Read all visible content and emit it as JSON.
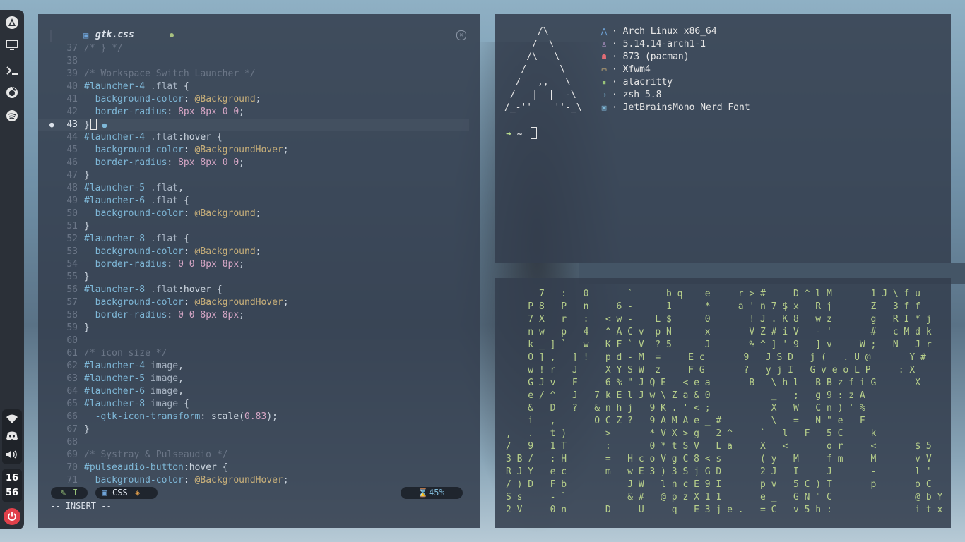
{
  "sidebar": {
    "top_icons": [
      "arch-logo-icon",
      "monitor-icon",
      "terminal-icon",
      "firefox-icon",
      "spotify-icon"
    ],
    "bottom_icons": [
      "wifi-icon",
      "discord-icon",
      "volume-icon"
    ],
    "clock": {
      "hour": "16",
      "minute": "56"
    },
    "power_icon": "power-icon"
  },
  "editor": {
    "tab": {
      "filename": "gtk.css",
      "modified": true
    },
    "lines": [
      {
        "n": "37",
        "t": "/* } */",
        "k": "com"
      },
      {
        "n": "38",
        "t": "",
        "k": "plain"
      },
      {
        "n": "39",
        "t": "/* Workspace Switch Launcher */",
        "k": "com"
      },
      {
        "n": "40",
        "t": "#launcher-4 .flat {",
        "k": "sel"
      },
      {
        "n": "41",
        "t": "  background-color: @Background;",
        "k": "decl"
      },
      {
        "n": "42",
        "t": "  border-radius: 8px 8px 0 0;",
        "k": "decl"
      },
      {
        "n": "43",
        "t": "}",
        "k": "cur"
      },
      {
        "n": "44",
        "t": "#launcher-4 .flat:hover {",
        "k": "sel"
      },
      {
        "n": "45",
        "t": "  background-color: @BackgroundHover;",
        "k": "decl"
      },
      {
        "n": "46",
        "t": "  border-radius: 8px 8px 0 0;",
        "k": "decl"
      },
      {
        "n": "47",
        "t": "}",
        "k": "plain"
      },
      {
        "n": "48",
        "t": "#launcher-5 .flat,",
        "k": "sel"
      },
      {
        "n": "49",
        "t": "#launcher-6 .flat {",
        "k": "sel"
      },
      {
        "n": "50",
        "t": "  background-color: @Background;",
        "k": "decl"
      },
      {
        "n": "51",
        "t": "}",
        "k": "plain"
      },
      {
        "n": "52",
        "t": "#launcher-8 .flat {",
        "k": "sel"
      },
      {
        "n": "53",
        "t": "  background-color: @Background;",
        "k": "decl"
      },
      {
        "n": "54",
        "t": "  border-radius: 0 0 8px 8px;",
        "k": "decl"
      },
      {
        "n": "55",
        "t": "}",
        "k": "plain"
      },
      {
        "n": "56",
        "t": "#launcher-8 .flat:hover {",
        "k": "sel"
      },
      {
        "n": "57",
        "t": "  background-color: @BackgroundHover;",
        "k": "decl"
      },
      {
        "n": "58",
        "t": "  border-radius: 0 0 8px 8px;",
        "k": "decl"
      },
      {
        "n": "59",
        "t": "}",
        "k": "plain"
      },
      {
        "n": "60",
        "t": "",
        "k": "plain"
      },
      {
        "n": "61",
        "t": "/* icon size */",
        "k": "com"
      },
      {
        "n": "62",
        "t": "#launcher-4 image,",
        "k": "sel"
      },
      {
        "n": "63",
        "t": "#launcher-5 image,",
        "k": "sel"
      },
      {
        "n": "64",
        "t": "#launcher-6 image,",
        "k": "sel"
      },
      {
        "n": "65",
        "t": "#launcher-8 image {",
        "k": "sel"
      },
      {
        "n": "66",
        "t": "  -gtk-icon-transform: scale(0.83);",
        "k": "decl"
      },
      {
        "n": "67",
        "t": "}",
        "k": "plain"
      },
      {
        "n": "68",
        "t": "",
        "k": "plain"
      },
      {
        "n": "69",
        "t": "/* Systray & Pulseaudio */",
        "k": "com"
      },
      {
        "n": "70",
        "t": "#pulseaudio-button:hover {",
        "k": "sel"
      },
      {
        "n": "71",
        "t": "  background-color: @BackgroundHover;",
        "k": "decl"
      }
    ],
    "current_line": "43",
    "status": {
      "mode": "I",
      "filetype": "CSS",
      "progress": "45%"
    },
    "modeline": "-- INSERT --"
  },
  "neofetch": {
    "ascii": [
      "      /\\",
      "     /  \\",
      "    /\\   \\",
      "   /      \\",
      "  /   ,,   \\",
      " /   |  |  -\\",
      "/_-''    ''-_\\"
    ],
    "info": [
      {
        "icon": "arch-icon",
        "color": "#6fa4d9",
        "glyph": "⋀",
        "text": "· Arch Linux x86_64"
      },
      {
        "icon": "linux-icon",
        "color": "#c6a0d8",
        "glyph": "♙",
        "text": "· 5.14.14-arch1-1"
      },
      {
        "icon": "package-icon",
        "color": "#e06c75",
        "glyph": "☗",
        "text": "· 873 (pacman)"
      },
      {
        "icon": "window-icon",
        "color": "#e5c07b",
        "glyph": "▭",
        "text": "· Xfwm4"
      },
      {
        "icon": "terminal-icon",
        "color": "#98c379",
        "glyph": "▪",
        "text": "· alacritty"
      },
      {
        "icon": "shell-icon",
        "color": "#7fb8d8",
        "glyph": "➔",
        "text": "· zsh 5.8"
      },
      {
        "icon": "font-icon",
        "color": "#7fb8d8",
        "glyph": "▣",
        "text": "· JetBrainsMono Nerd Font"
      }
    ],
    "prompt": {
      "arrow": "➜",
      "dir": "~"
    }
  },
  "matrix": {
    "rows": [
      "      7   :   0       `      b q    e     r > #     D ^ l M       1 J \\ f u",
      "    P 8   P   n     6 -      1      *     a ' n 7 $ x   R j       Z   3 f f",
      "    7 X   r   :   < w -    L $      0       ! J . K 8   w z       g   R I * j",
      "    n w   p   4   ^ A C v  p N      x       V Z # i V   - '       #   c M d k",
      "    k _ ] `   w   K F ` V  ? 5      J       % ^ ] ' 9   ] v     W ;   N   J r",
      "    O ] ,   ] !   p d - M  =     E c       9   J S D   j (   . U @       Y #",
      "    w ! r   J     X Y S W  z     F G       ?   y j I   G v e o L P     : X",
      "    G J v   F     6 % \" J Q E   < e a       B   \\ h l   B B z f i G       X",
      "    e / ^   J   7 k E l J w \\ Z a & 0           _   ;   g 9 : z A",
      "    &   D   ?   & n h j   9 K . ' < ;           X   W   C n ) ' %",
      "    i   ,       O C Z ?   9 A M A e _ #         \\   =   N \" e   F",
      ",   .   t )       >       * V X > g   2 ^     `   l   F   5 C     k",
      "/   9   1 T       :       0 * t S V   L a     X   <       o r     <       $ 5",
      "3 B /   : H       =   H c o V g C 8 < s       ( y   M     f m     M       v V",
      "R J Y   e c       m   w E 3 ) 3 S j G D       2 J   I     J       -       l '",
      "/ ) D   F b           J W   l n c E 9 I       p v   5 C ) T       p       o C",
      "S s     - `           & #   @ p z X 1 1       e _   G N \" C               @ b Y",
      "2 V     0 n       D     U     q   E 3 j e .   = C   v 5 h :               i t x"
    ]
  }
}
